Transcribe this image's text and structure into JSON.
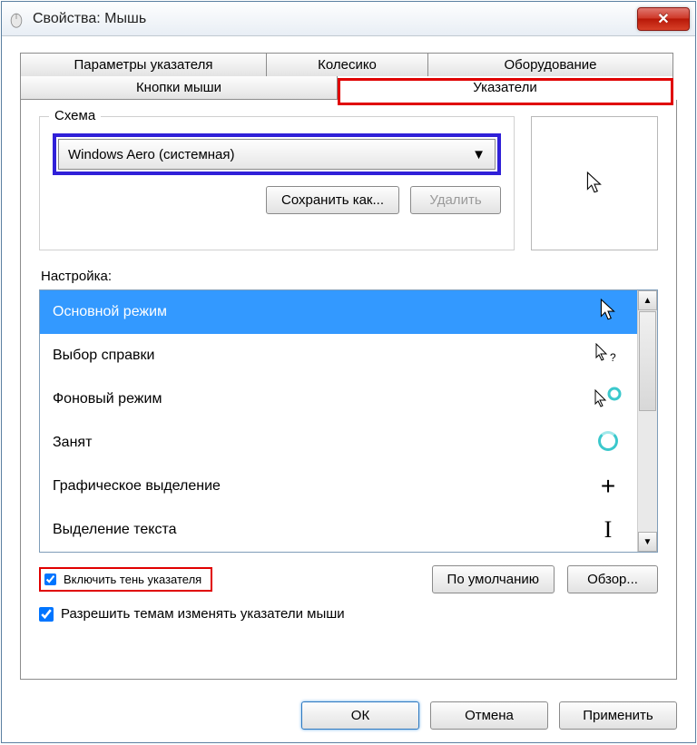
{
  "window": {
    "title": "Свойства: Мышь"
  },
  "tabs": {
    "row1": [
      "Параметры указателя",
      "Колесико",
      "Оборудование"
    ],
    "row2": [
      "Кнопки мыши",
      "Указатели"
    ]
  },
  "scheme": {
    "legend": "Схема",
    "selected": "Windows Aero (системная)",
    "save_as": "Сохранить как...",
    "delete": "Удалить"
  },
  "list": {
    "label": "Настройка:",
    "items": [
      {
        "label": "Основной режим",
        "icon": "arrow",
        "selected": true
      },
      {
        "label": "Выбор справки",
        "icon": "arrow-help"
      },
      {
        "label": "Фоновый режим",
        "icon": "arrow-wait"
      },
      {
        "label": "Занят",
        "icon": "wait"
      },
      {
        "label": "Графическое выделение",
        "icon": "cross"
      },
      {
        "label": "Выделение текста",
        "icon": "ibeam"
      }
    ]
  },
  "checks": {
    "shadow": "Включить тень указателя",
    "themes": "Разрешить темам изменять указатели мыши"
  },
  "buttons": {
    "defaults": "По умолчанию",
    "browse": "Обзор...",
    "ok": "ОК",
    "cancel": "Отмена",
    "apply": "Применить"
  }
}
